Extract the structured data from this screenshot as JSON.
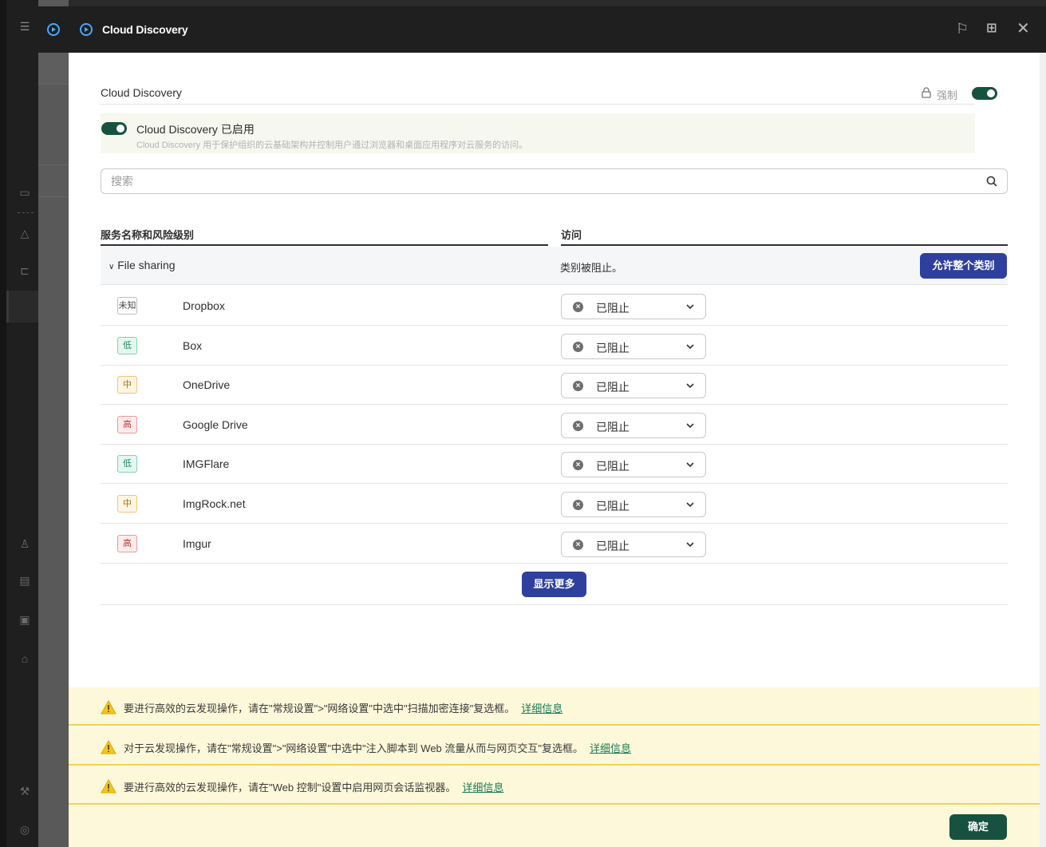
{
  "window": {
    "title": "Cloud Discovery"
  },
  "section": {
    "label": "Cloud Discovery",
    "force_label": "强制",
    "force_enabled": true
  },
  "banner": {
    "enabled": true,
    "title": "Cloud Discovery 已启用",
    "description": "Cloud Discovery 用于保护组织的云基础架构并控制用户通过浏览器和桌面应用程序对云服务的访问。"
  },
  "search": {
    "placeholder": "搜索",
    "value": ""
  },
  "table": {
    "col_service": "服务名称和风险级别",
    "col_access": "访问",
    "category": {
      "name": "File sharing",
      "status": "类别被阻止。",
      "allow_button": "允许整个类别"
    },
    "rows": [
      {
        "risk_label": "未知",
        "risk_level": "unknown",
        "name": "Dropbox",
        "access": "已阻止"
      },
      {
        "risk_label": "低",
        "risk_level": "low",
        "name": "Box",
        "access": "已阻止"
      },
      {
        "risk_label": "中",
        "risk_level": "mid",
        "name": "OneDrive",
        "access": "已阻止"
      },
      {
        "risk_label": "高",
        "risk_level": "high",
        "name": "Google Drive",
        "access": "已阻止"
      },
      {
        "risk_label": "低",
        "risk_level": "low",
        "name": "IMGFlare",
        "access": "已阻止"
      },
      {
        "risk_label": "中",
        "risk_level": "mid",
        "name": "ImgRock.net",
        "access": "已阻止"
      },
      {
        "risk_label": "高",
        "risk_level": "high",
        "name": "Imgur",
        "access": "已阻止"
      }
    ],
    "show_more": "显示更多"
  },
  "warnings": [
    {
      "text": "要进行高效的云发现操作，请在\"常规设置\">\"网络设置\"中选中\"扫描加密连接\"复选框。",
      "link": "详细信息"
    },
    {
      "text": "对于云发现操作，请在\"常规设置\">\"网络设置\"中选中\"注入脚本到 Web 流量从而与网页交互\"复选框。",
      "link": "详细信息"
    },
    {
      "text": "要进行高效的云发现操作，请在\"Web 控制\"设置中启用网页会话监视器。",
      "link": "详细信息"
    }
  ],
  "footer": {
    "ok_label": "确定"
  },
  "colors": {
    "accent_green": "#16523f",
    "primary_blue": "#2f3f9e",
    "warning_bg": "#fdf8d9"
  }
}
